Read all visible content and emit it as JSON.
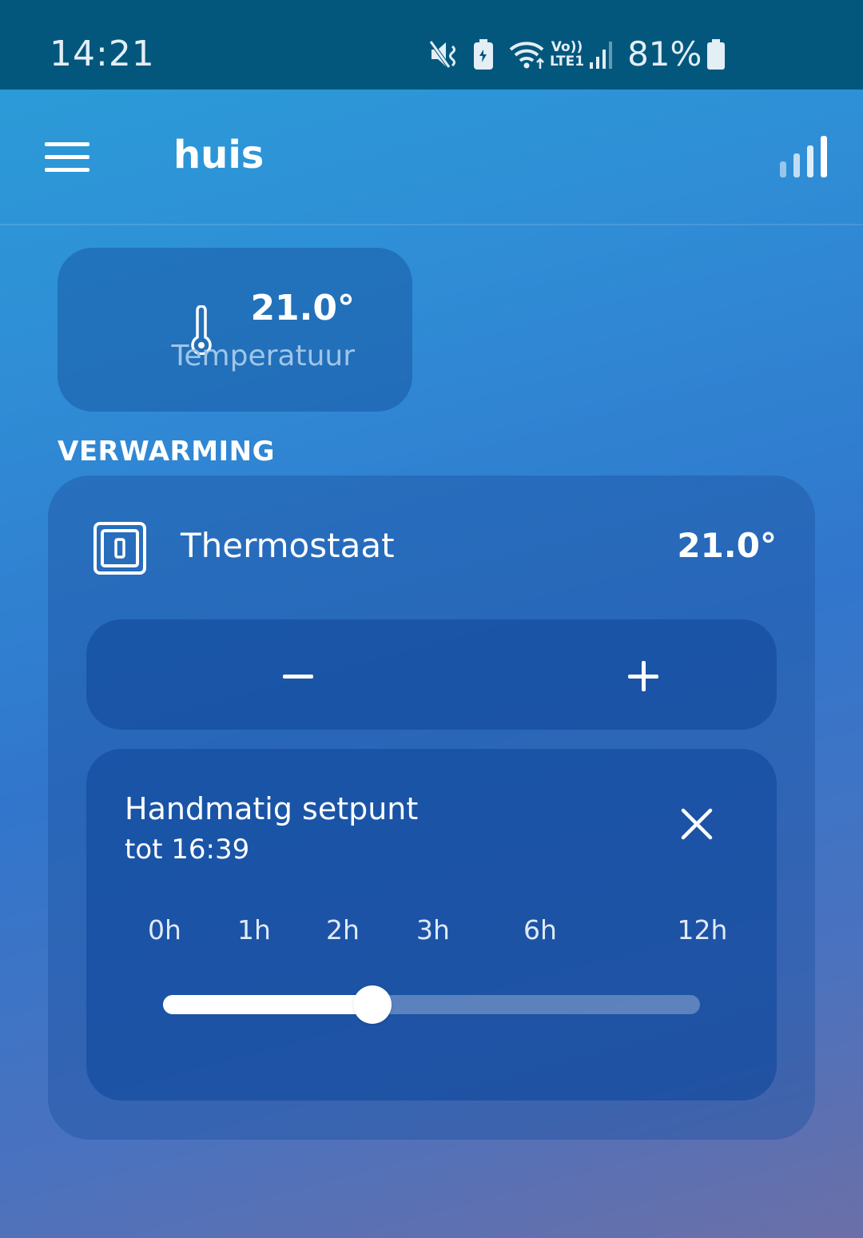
{
  "status_bar": {
    "time": "14:21",
    "lte": "Vo))\nLTE1",
    "battery_percent": "81%",
    "icons": [
      "mute-icon",
      "battery-saver-icon",
      "wifi-icon",
      "volte-icon",
      "cellular-signal-icon",
      "battery-icon"
    ]
  },
  "app_bar": {
    "title": "huis",
    "menu_icon": "hamburger-menu-icon",
    "action_icon": "statistics-icon"
  },
  "temperature_card": {
    "value": "21.0°",
    "label": "Temperatuur",
    "icon": "thermometer-icon"
  },
  "section": {
    "title": "VERWARMING"
  },
  "thermostat": {
    "name": "Thermostaat",
    "temperature": "21.0°",
    "icon": "thermostat-device-icon",
    "stepper": {
      "decrease_label": "−",
      "increase_label": "+"
    },
    "setpoint": {
      "title": "Handmatig setpunt",
      "until": "tot 16:39",
      "close_icon": "close-icon",
      "duration_options": [
        "0h",
        "1h",
        "2h",
        "3h",
        "6h",
        "12h"
      ],
      "slider_value_fraction": 0.39
    }
  },
  "colors": {
    "status_bar": "#03577d",
    "accent_white": "#ffffff",
    "secondary_text": "#9fc6e8"
  }
}
